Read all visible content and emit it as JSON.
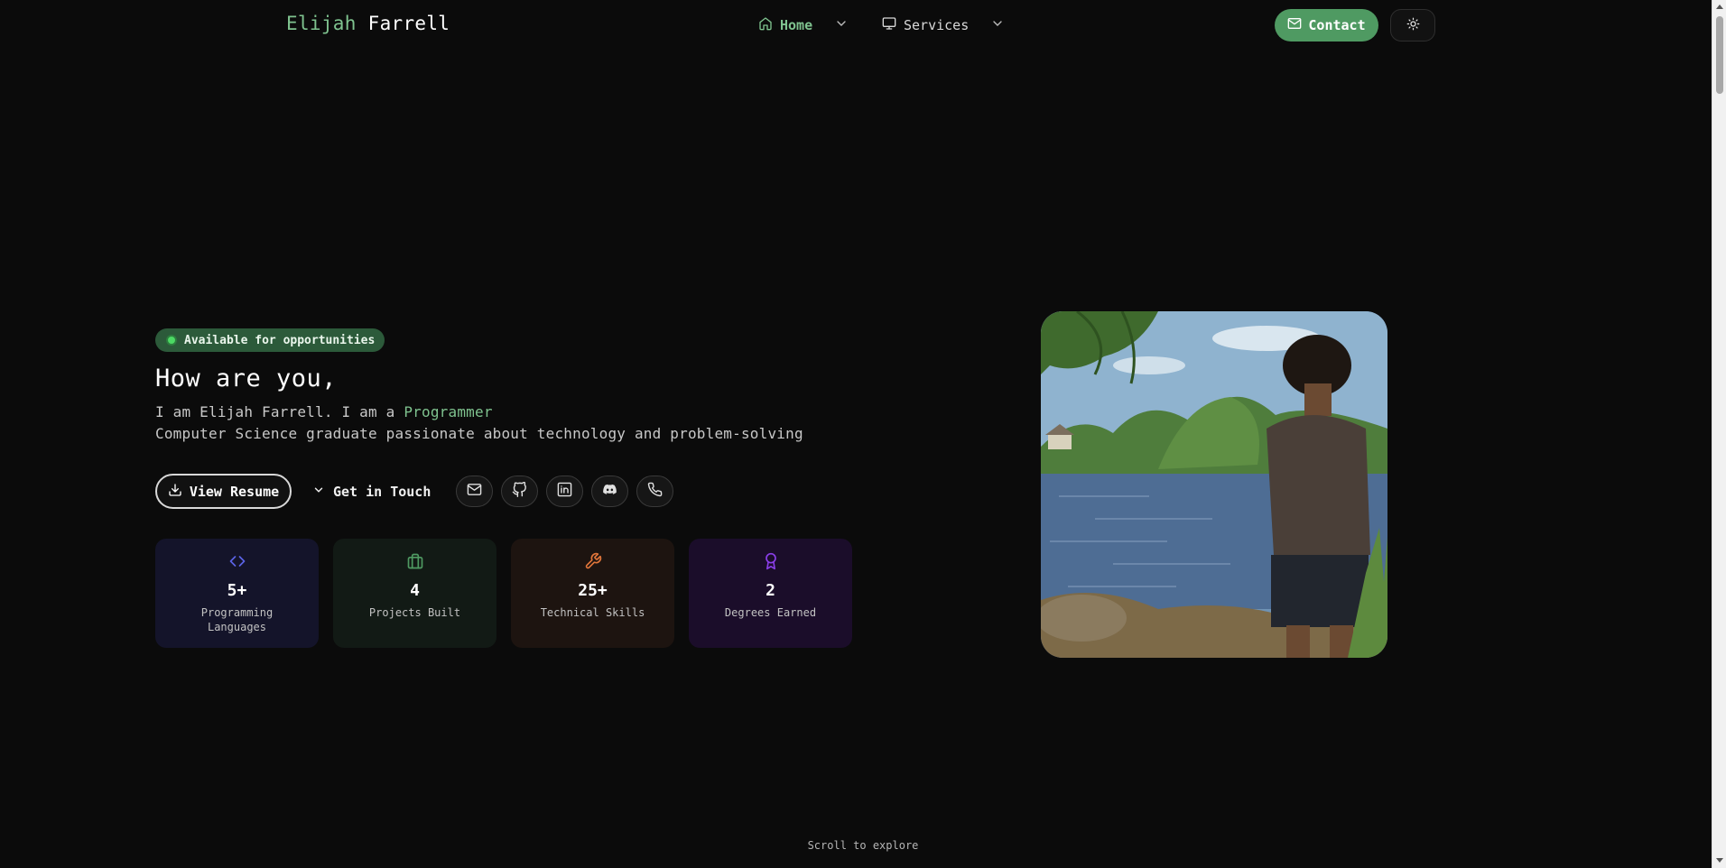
{
  "nav": {
    "brand_first": "Elijah",
    "brand_last": "Farrell",
    "home_label": "Home",
    "services_label": "Services",
    "contact_label": "Contact"
  },
  "hero": {
    "badge": "Available for opportunities",
    "greeting": "How are you,",
    "intro_prefix": "I am Elijah Farrell. I am a",
    "intro_role": "Programmer",
    "tagline": "Computer Science graduate passionate about technology and problem-solving",
    "resume_label": "View Resume",
    "touch_label": "Get in Touch"
  },
  "socials": [
    {
      "icon": "mail-icon"
    },
    {
      "icon": "github-icon"
    },
    {
      "icon": "linkedin-icon"
    },
    {
      "icon": "discord-icon"
    },
    {
      "icon": "phone-icon"
    }
  ],
  "stats": [
    {
      "value": "5+",
      "label": "Programming Languages",
      "icon": "code-icon",
      "color": "#5b63e6"
    },
    {
      "value": "4",
      "label": "Projects Built",
      "icon": "briefcase-icon",
      "color": "#4f9a62"
    },
    {
      "value": "25+",
      "label": "Technical Skills",
      "icon": "wrench-icon",
      "color": "#e0753a"
    },
    {
      "value": "2",
      "label": "Degrees Earned",
      "icon": "award-icon",
      "color": "#8a3ee8"
    }
  ],
  "colors": {
    "accent": "#7fc38f",
    "contact_bg": "#4f9a62",
    "badge_bg": "#2c5a3a",
    "page_bg": "#0b0b0b"
  },
  "footer": {
    "scroll_hint": "Scroll to explore"
  }
}
